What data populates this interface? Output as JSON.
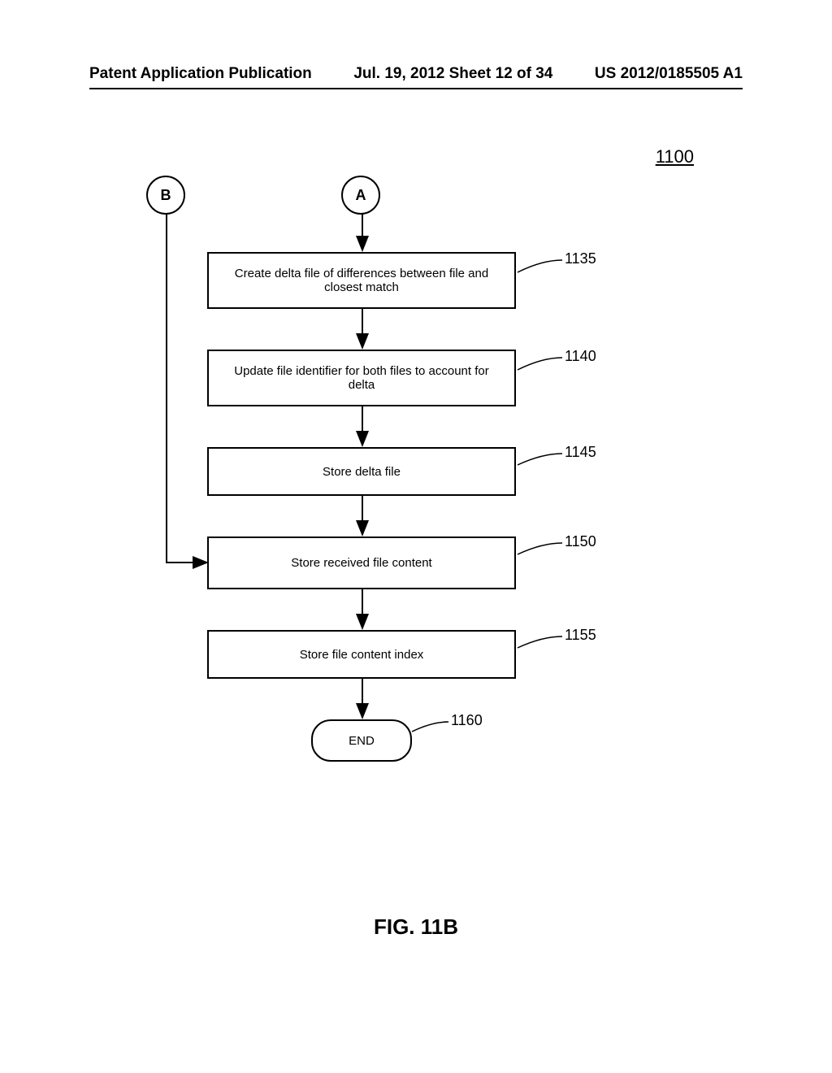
{
  "header": {
    "left": "Patent Application Publication",
    "center": "Jul. 19, 2012  Sheet 12 of 34",
    "right": "US 2012/0185505 A1"
  },
  "diagram": {
    "main_ref": "1100",
    "connectors": {
      "b": "B",
      "a": "A"
    },
    "boxes": {
      "b1135": {
        "text": "Create delta file of differences between file and closest match",
        "ref": "1135"
      },
      "b1140": {
        "text": "Update file identifier for both files to account for delta",
        "ref": "1140"
      },
      "b1145": {
        "text": "Store delta file",
        "ref": "1145"
      },
      "b1150": {
        "text": "Store received file content",
        "ref": "1150"
      },
      "b1155": {
        "text": "Store file content index",
        "ref": "1155"
      }
    },
    "end": {
      "text": "END",
      "ref": "1160"
    }
  },
  "figure_label": "FIG. 11B"
}
